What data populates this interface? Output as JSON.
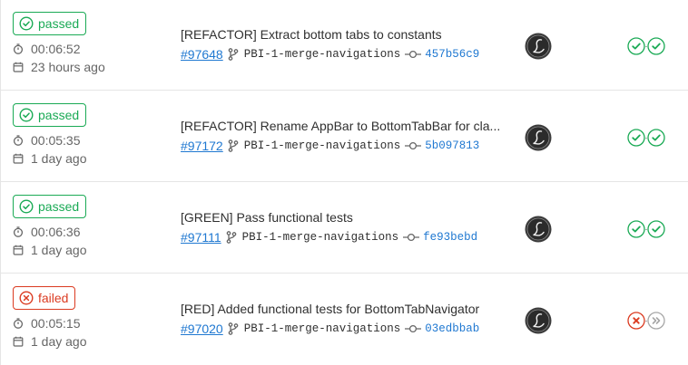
{
  "colors": {
    "success": "#1aaa55",
    "failed": "#db3b21",
    "link": "#1f78d1",
    "skipped": "#a7a7a7"
  },
  "pipelines": [
    {
      "status": "passed",
      "duration": "00:06:52",
      "finished": "23 hours ago",
      "commit_title": "[REFACTOR] Extract bottom tabs to constants",
      "pipeline_id": "#97648",
      "branch": "PBI-1-merge-navigations",
      "sha": "457b56c9",
      "stages": [
        "success-icon",
        "success-icon"
      ]
    },
    {
      "status": "passed",
      "duration": "00:05:35",
      "finished": "1 day ago",
      "commit_title": "[REFACTOR] Rename AppBar to BottomTabBar for cla...",
      "pipeline_id": "#97172",
      "branch": "PBI-1-merge-navigations",
      "sha": "5b097813",
      "stages": [
        "success-icon",
        "success-icon"
      ]
    },
    {
      "status": "passed",
      "duration": "00:06:36",
      "finished": "1 day ago",
      "commit_title": "[GREEN] Pass functional tests",
      "pipeline_id": "#97111",
      "branch": "PBI-1-merge-navigations",
      "sha": "fe93bebd",
      "stages": [
        "success-icon",
        "success-icon"
      ]
    },
    {
      "status": "failed",
      "duration": "00:05:15",
      "finished": "1 day ago",
      "commit_title": "[RED] Added functional tests for BottomTabNavigator",
      "pipeline_id": "#97020",
      "branch": "PBI-1-merge-navigations",
      "sha": "03edbbab",
      "stages": [
        "failed-icon",
        "skipped-icon"
      ]
    }
  ]
}
